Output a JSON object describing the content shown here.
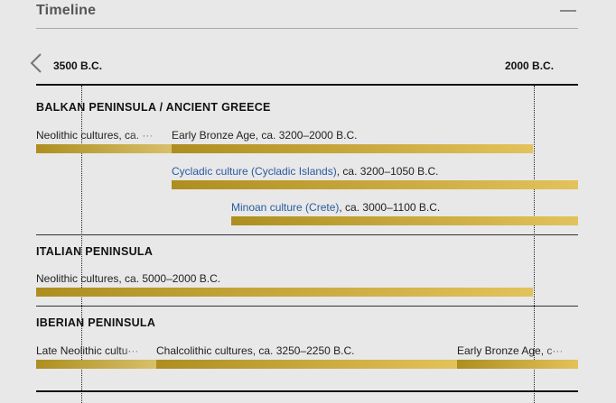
{
  "header": {
    "title": "Timeline"
  },
  "axis": {
    "start_label": "3500 B.C.",
    "end_label": "2000 B.C."
  },
  "regions": [
    {
      "title": "BALKAN PENINSULA / ANCIENT GREECE",
      "rows": [
        {
          "items": [
            {
              "text": "Neolithic cultures, ca. ···"
            },
            {
              "text": "Early Bronze Age, ca. 3200–2000 B.C."
            }
          ]
        },
        {
          "items": [
            {
              "link": "Cycladic culture (Cycladic Islands)",
              "text": ", ca. 3200–1050 B.C."
            }
          ]
        },
        {
          "items": [
            {
              "link": "Minoan culture (Crete)",
              "text": ", ca. 3000–1100 B.C."
            }
          ]
        }
      ]
    },
    {
      "title": "ITALIAN PENINSULA",
      "rows": [
        {
          "items": [
            {
              "text": "Neolithic cultures, ca. 5000–2000 B.C."
            }
          ]
        }
      ]
    },
    {
      "title": "IBERIAN PENINSULA",
      "rows": [
        {
          "items": [
            {
              "text": "Late Neolithic cultu···"
            },
            {
              "text": "Chalcolithic cultures, ca. 3250–2250 B.C."
            },
            {
              "text": "Early Bronze Age, c···"
            }
          ]
        }
      ]
    }
  ]
}
